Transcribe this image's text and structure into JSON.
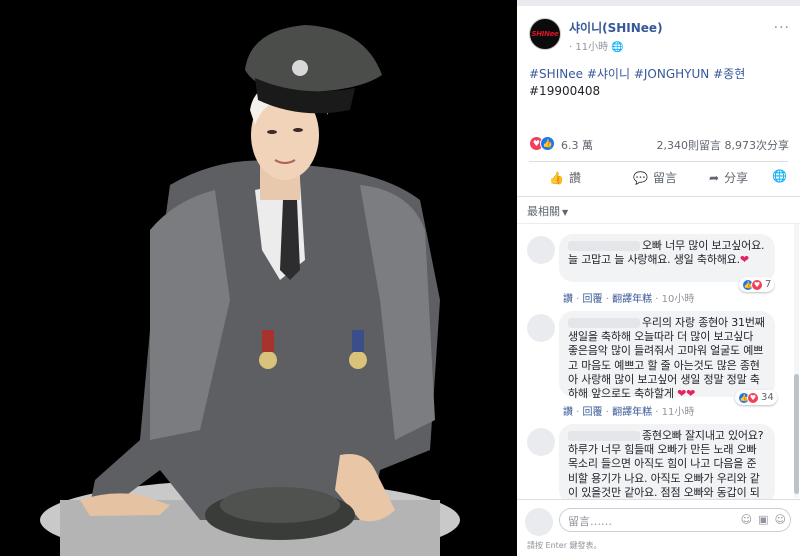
{
  "post": {
    "page_name": "샤이니(SHINee)",
    "time": "11小時",
    "privacy_icon": "globe-icon",
    "more_label": "···",
    "hashtags": [
      "#SHINee",
      "#샤이니",
      "#JONGHYUN",
      "#종현"
    ],
    "second_line": "#19900408",
    "avatar_text": "SHINee"
  },
  "stats": {
    "reactions": "6.3 萬",
    "comments": "2,340則留言",
    "shares": "8,973次分享"
  },
  "actions": {
    "like": "讚",
    "comment": "留言",
    "share": "分享"
  },
  "sort": {
    "label": "最相關"
  },
  "comments": [
    {
      "text": "오빠 너무 많이 보고싶어요. 늘 고맙고 늘 사랑해요. 생일 축하해요.",
      "emoji": "❤",
      "like": "讚",
      "reply": "回覆",
      "translate": "翻譯年糕",
      "time": "10小時",
      "reaction_count": "7"
    },
    {
      "text": "우리의 자랑 종현아 31번째 생일을 축하해 오늘따라 더 많이 보고싶다 좋은음악 많이 들려줘서 고마워 얼굴도 예쁘고 마음도 예쁘고 할 줄 아는것도 많은 종현아 사랑해 많이 보고싶어 생일 정말 정말 축하해 앞으로도 축하할게",
      "emoji": "❤❤",
      "like": "讚",
      "reply": "回覆",
      "translate": "翻譯年糕",
      "time": "11小時",
      "reaction_count": "34"
    },
    {
      "text": "종현오빠 잘지내고 있어요? 하루가 너무 힘들때 오빠가 만든 노래 오빠 목소리 들으면 아직도 힘이 나고 다음을 준비할 용기가 나요. 아직도 오빠가 우리와 같이 있을것만 같아요. 점점 오빠와 동갑이 되어가고있어요. 마냥 안올것 같던 날들"
    }
  ],
  "input": {
    "placeholder": "留言……",
    "hint": "請按 Enter 鍵發表。"
  },
  "colors": {
    "link": "#365899",
    "like_blue": "#1877f2",
    "love_red": "#f33e58",
    "panel_bg": "#ffffff",
    "photo_bg": "#000000"
  }
}
